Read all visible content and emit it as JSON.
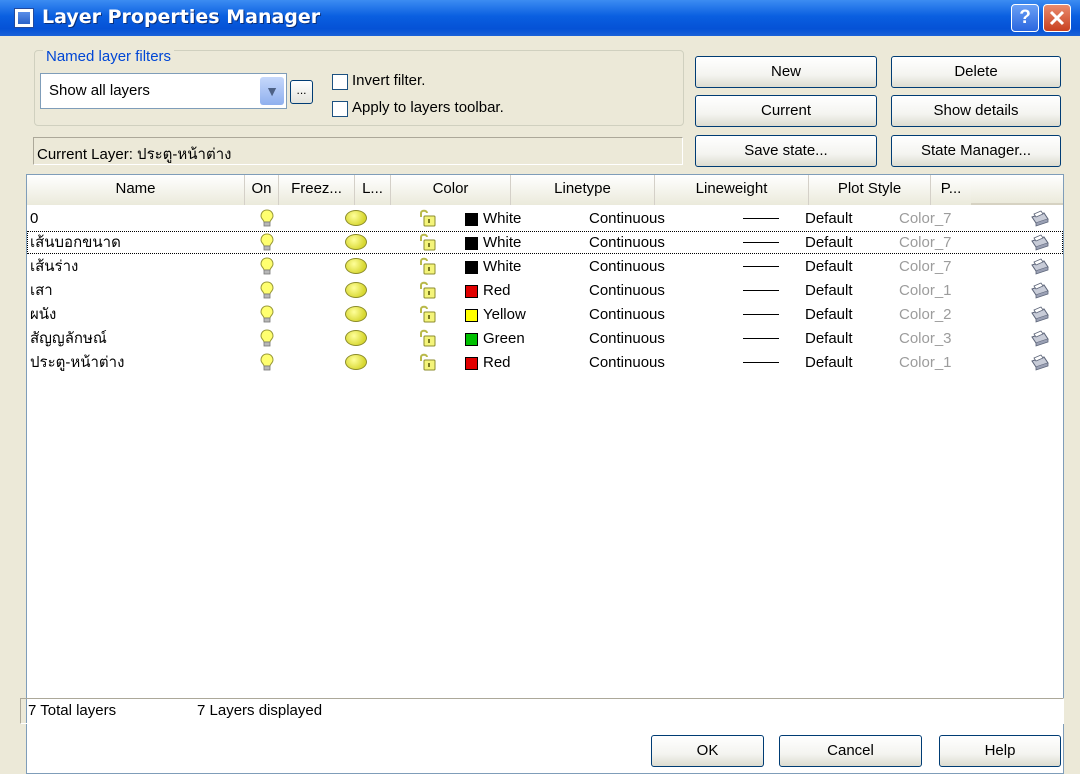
{
  "window": {
    "title": "Layer Properties Manager"
  },
  "filters": {
    "legend": "Named layer filters",
    "combo_value": "Show all layers",
    "more_button": "...",
    "invert_label": "Invert filter.",
    "apply_label": "Apply to layers toolbar."
  },
  "buttons": {
    "new": "New",
    "delete": "Delete",
    "current": "Current",
    "show_details": "Show details",
    "save_state": "Save state...",
    "state_manager": "State Manager..."
  },
  "current_layer": "Current Layer:  ประตู-หน้าต่าง",
  "table": {
    "headers": [
      "Name",
      "On",
      "Freez...",
      "L...",
      "Color",
      "Linetype",
      "Lineweight",
      "Plot Style",
      "P..."
    ],
    "rows": [
      {
        "name": "0",
        "color": "White",
        "color_hex": "#000000",
        "linetype": "Continuous",
        "lineweight": "Default",
        "plot_style": "Color_7"
      },
      {
        "name": "เส้นบอกขนาด",
        "color": "White",
        "color_hex": "#000000",
        "linetype": "Continuous",
        "lineweight": "Default",
        "plot_style": "Color_7"
      },
      {
        "name": "เส้นร่าง",
        "color": "White",
        "color_hex": "#000000",
        "linetype": "Continuous",
        "lineweight": "Default",
        "plot_style": "Color_7"
      },
      {
        "name": "เสา",
        "color": "Red",
        "color_hex": "#e00000",
        "linetype": "Continuous",
        "lineweight": "Default",
        "plot_style": "Color_1"
      },
      {
        "name": "ผนัง",
        "color": "Yellow",
        "color_hex": "#ffff00",
        "linetype": "Continuous",
        "lineweight": "Default",
        "plot_style": "Color_2"
      },
      {
        "name": "สัญญลักษณ์",
        "color": "Green",
        "color_hex": "#00c000",
        "linetype": "Continuous",
        "lineweight": "Default",
        "plot_style": "Color_3"
      },
      {
        "name": "ประตู-หน้าต่าง",
        "color": "Red",
        "color_hex": "#e00000",
        "linetype": "Continuous",
        "lineweight": "Default",
        "plot_style": "Color_1"
      }
    ]
  },
  "status": {
    "total": "7 Total layers",
    "displayed": "7 Layers displayed"
  },
  "footer": {
    "ok": "OK",
    "cancel": "Cancel",
    "help": "Help"
  },
  "icons": {
    "on": "lightbulb-icon",
    "freeze": "sun-icon",
    "lock": "padlock-icon",
    "plot": "printer-icon"
  }
}
